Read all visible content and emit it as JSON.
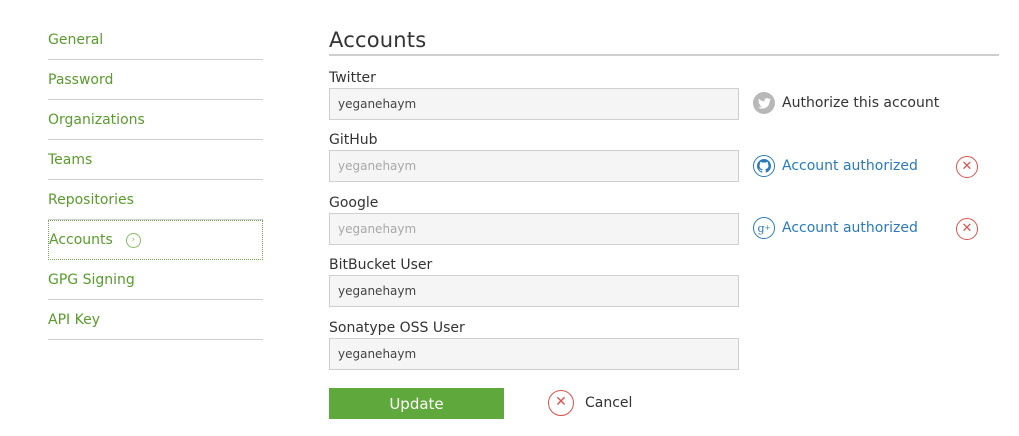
{
  "sidebar": {
    "items": [
      {
        "label": "General"
      },
      {
        "label": "Password"
      },
      {
        "label": "Organizations"
      },
      {
        "label": "Teams"
      },
      {
        "label": "Repositories"
      },
      {
        "label": "Accounts",
        "active": true
      },
      {
        "label": "GPG Signing"
      },
      {
        "label": "API Key"
      }
    ]
  },
  "main": {
    "title": "Accounts",
    "fields": {
      "twitter": {
        "label": "Twitter",
        "value": "yeganehaym",
        "auth_text": "Authorize this account",
        "icon": "twitter-icon"
      },
      "github": {
        "label": "GitHub",
        "value": "yeganehaym",
        "auth_text": "Account authorized",
        "icon": "github-icon"
      },
      "google": {
        "label": "Google",
        "value": "yeganehaym",
        "auth_text": "Account authorized",
        "icon": "google-plus-icon"
      },
      "bitbucket": {
        "label": "BitBucket User",
        "value": "yeganehaym"
      },
      "sonatype": {
        "label": "Sonatype OSS User",
        "value": "yeganehaym"
      }
    },
    "update_label": "Update",
    "cancel_label": "Cancel"
  },
  "colors": {
    "accent_green": "#5fa93c",
    "link_blue": "#2a7ab8",
    "remove_red": "#d9534f"
  }
}
